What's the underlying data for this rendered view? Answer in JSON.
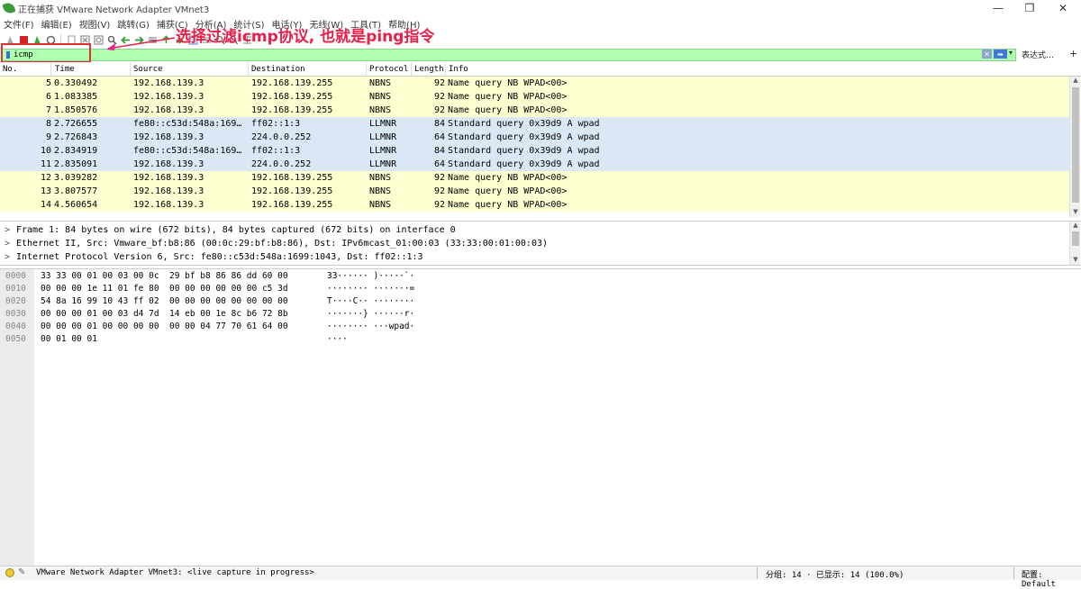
{
  "window": {
    "title": "正在捕获 VMware Network Adapter VMnet3",
    "minimize": "—",
    "maximize": "❐",
    "close": "✕"
  },
  "menu": [
    "文件(F)",
    "编辑(E)",
    "视图(V)",
    "跳转(G)",
    "捕获(C)",
    "分析(A)",
    "统计(S)",
    "电话(Y)",
    "无线(W)",
    "工具(T)",
    "帮助(H)"
  ],
  "annotation": "选择过滤icmp协议, 也就是ping指令",
  "filter": {
    "value": "icmp",
    "expression_label": "表达式…",
    "add_label": "+",
    "clear_icon": "x",
    "apply_icon": "arrow-right",
    "colors": {
      "valid": "#afffaf",
      "highlight_box": "#e03030",
      "annotation": "#e8204a"
    }
  },
  "packet_list": {
    "columns": [
      "No.",
      "Time",
      "Source",
      "Destination",
      "Protocol",
      "Length",
      "Info"
    ],
    "row_colors": {
      "NBNS": "#feffd0",
      "LLMNR": "#dae8f6"
    },
    "rows": [
      {
        "no": "5",
        "time": "0.330492",
        "src": "192.168.139.3",
        "dst": "192.168.139.255",
        "proto": "NBNS",
        "len": "92",
        "info": "Name query NB WPAD<00>"
      },
      {
        "no": "6",
        "time": "1.083385",
        "src": "192.168.139.3",
        "dst": "192.168.139.255",
        "proto": "NBNS",
        "len": "92",
        "info": "Name query NB WPAD<00>"
      },
      {
        "no": "7",
        "time": "1.850576",
        "src": "192.168.139.3",
        "dst": "192.168.139.255",
        "proto": "NBNS",
        "len": "92",
        "info": "Name query NB WPAD<00>"
      },
      {
        "no": "8",
        "time": "2.726655",
        "src": "fe80::c53d:548a:169…",
        "dst": "ff02::1:3",
        "proto": "LLMNR",
        "len": "84",
        "info": "Standard query 0x39d9 A wpad"
      },
      {
        "no": "9",
        "time": "2.726843",
        "src": "192.168.139.3",
        "dst": "224.0.0.252",
        "proto": "LLMNR",
        "len": "64",
        "info": "Standard query 0x39d9 A wpad"
      },
      {
        "no": "10",
        "time": "2.834919",
        "src": "fe80::c53d:548a:169…",
        "dst": "ff02::1:3",
        "proto": "LLMNR",
        "len": "84",
        "info": "Standard query 0x39d9 A wpad"
      },
      {
        "no": "11",
        "time": "2.835091",
        "src": "192.168.139.3",
        "dst": "224.0.0.252",
        "proto": "LLMNR",
        "len": "64",
        "info": "Standard query 0x39d9 A wpad"
      },
      {
        "no": "12",
        "time": "3.039282",
        "src": "192.168.139.3",
        "dst": "192.168.139.255",
        "proto": "NBNS",
        "len": "92",
        "info": "Name query NB WPAD<00>"
      },
      {
        "no": "13",
        "time": "3.807577",
        "src": "192.168.139.3",
        "dst": "192.168.139.255",
        "proto": "NBNS",
        "len": "92",
        "info": "Name query NB WPAD<00>"
      },
      {
        "no": "14",
        "time": "4.560654",
        "src": "192.168.139.3",
        "dst": "192.168.139.255",
        "proto": "NBNS",
        "len": "92",
        "info": "Name query NB WPAD<00>"
      }
    ]
  },
  "details": [
    "Frame 1: 84 bytes on wire (672 bits), 84 bytes captured (672 bits) on interface 0",
    "Ethernet II, Src: Vmware_bf:b8:86 (00:0c:29:bf:b8:86), Dst: IPv6mcast_01:00:03 (33:33:00:01:00:03)",
    "Internet Protocol Version 6, Src: fe80::c53d:548a:1699:1043, Dst: ff02::1:3"
  ],
  "bytes": [
    {
      "off": "0000",
      "hex": "33 33 00 01 00 03 00 0c  29 bf b8 86 86 dd 60 00",
      "ascii": "33······ )·····`·"
    },
    {
      "off": "0010",
      "hex": "00 00 00 1e 11 01 fe 80  00 00 00 00 00 00 c5 3d",
      "ascii": "········ ·······="
    },
    {
      "off": "0020",
      "hex": "54 8a 16 99 10 43 ff 02  00 00 00 00 00 00 00 00",
      "ascii": "T····C·· ········"
    },
    {
      "off": "0030",
      "hex": "00 00 00 01 00 03 d4 7d  14 eb 00 1e 8c b6 72 8b",
      "ascii": "·······} ······r·"
    },
    {
      "off": "0040",
      "hex": "00 00 00 01 00 00 00 00  00 00 04 77 70 61 64 00",
      "ascii": "········ ···wpad·"
    },
    {
      "off": "0050",
      "hex": "00 01 00 01",
      "ascii": "····"
    }
  ],
  "status": {
    "capture_text": "VMware Network Adapter VMnet3: <live capture in progress>",
    "counts": "分组: 14 · 已显示: 14 (100.0%)",
    "profile": "配置: Default"
  }
}
